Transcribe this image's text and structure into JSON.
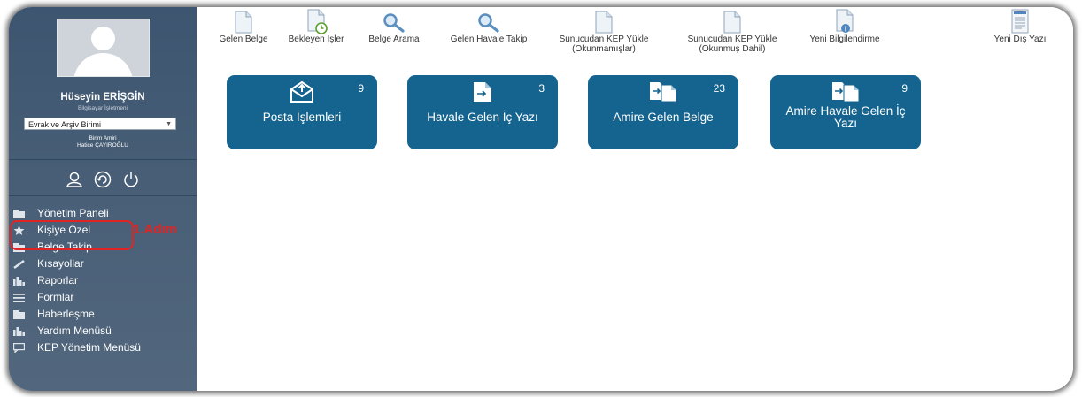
{
  "user": {
    "name": "Hüseyin ERİŞGİN",
    "title": "Bilgisayar İşletmeni",
    "unit_selected": "Evrak ve Arşiv Birimi",
    "role": "Birim Amiri",
    "manager": "Hatice ÇAYIROĞLU"
  },
  "sidebar": {
    "icons": [
      "user-icon",
      "refresh-icon",
      "power-icon"
    ],
    "menu": [
      {
        "label": "Yönetim Paneli",
        "icon": "folder-icon"
      },
      {
        "label": "Kişiye Özel",
        "icon": "star-icon"
      },
      {
        "label": "Belge Takip",
        "icon": "folder-icon"
      },
      {
        "label": "Kısayollar",
        "icon": "pencil-icon"
      },
      {
        "label": "Raporlar",
        "icon": "bar-chart-icon"
      },
      {
        "label": "Formlar",
        "icon": "list-icon"
      },
      {
        "label": "Haberleşme",
        "icon": "folder-icon"
      },
      {
        "label": "Yardım Menüsü",
        "icon": "bar-chart-icon"
      },
      {
        "label": "KEP Yönetim Menüsü",
        "icon": "chat-icon"
      }
    ]
  },
  "annotation": {
    "step_label": "1.Adım",
    "color": "#e02424"
  },
  "toolbar": {
    "items": [
      {
        "label": "Gelen Belge",
        "icon": "document-icon"
      },
      {
        "label": "Bekleyen İşler",
        "icon": "document-clock-icon"
      },
      {
        "label": "Belge Arama",
        "icon": "magnifier-icon"
      },
      {
        "label": "Gelen Havale Takip",
        "icon": "magnifier-icon"
      },
      {
        "label": "Sunucudan KEP Yükle",
        "sub": "(Okunmamışlar)",
        "icon": "document-icon"
      },
      {
        "label": "Sunucudan KEP Yükle",
        "sub": "(Okunmuş Dahil)",
        "icon": "document-icon"
      },
      {
        "label": "Yeni Bilgilendirme",
        "icon": "document-info-icon"
      },
      {
        "label": "Yeni Dış Yazı",
        "icon": "document-lines-icon"
      }
    ]
  },
  "tiles": [
    {
      "label": "Posta İşlemleri",
      "count": "9",
      "icon": "mail-icon"
    },
    {
      "label": "Havale Gelen İç Yazı",
      "count": "3",
      "icon": "arrow-document-icon"
    },
    {
      "label": "Amire Gelen Belge",
      "count": "23",
      "icon": "forward-documents-icon"
    },
    {
      "label": "Amire Havale Gelen İç Yazı",
      "count": "9",
      "icon": "forward-documents-icon"
    }
  ],
  "colors": {
    "sidebar": "#46607a",
    "tile": "#14648f",
    "accent_highlight": "#e02424"
  }
}
